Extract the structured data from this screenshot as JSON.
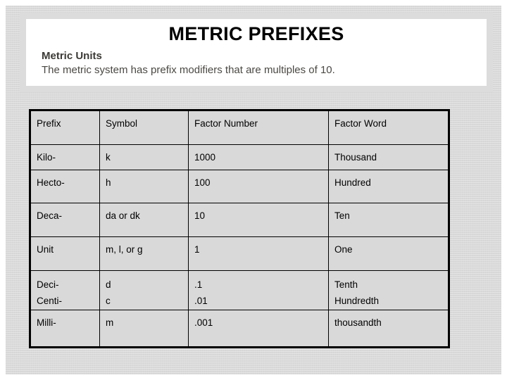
{
  "slide": {
    "title": "METRIC PREFIXES",
    "subhead": "Metric Units",
    "subtext": "The metric system has prefix modifiers that are multiples of 10.",
    "background_color": "#d9d9d9",
    "header_frame_color": "#dcdcdc",
    "header_inner_color": "#ffffff",
    "title_color": "#000000",
    "subhead_color": "#3c3a36",
    "subtext_color": "#4a4843"
  },
  "table": {
    "border_color": "#000000",
    "cell_background": "#d9d9d9",
    "text_color": "#000000",
    "headers": [
      "Prefix",
      "Symbol",
      "Factor Number",
      "Factor Word"
    ],
    "rows": [
      {
        "prefix": "Kilo-",
        "symbol": "k",
        "factor_number": "1000",
        "factor_word": "Thousand"
      },
      {
        "prefix": "Hecto-",
        "symbol": "h",
        "factor_number": "100",
        "factor_word": "Hundred"
      },
      {
        "prefix": "Deca-",
        "symbol": "da or dk",
        "factor_number": "10",
        "factor_word": "Ten"
      },
      {
        "prefix": "Unit",
        "symbol": "m, l, or g",
        "factor_number": "1",
        "factor_word": "One"
      },
      {
        "prefix": "Deci-",
        "symbol": "d",
        "factor_number": ".1",
        "factor_word": "Tenth"
      },
      {
        "prefix": "Centi-",
        "symbol": "c",
        "factor_number": ".01",
        "factor_word": "Hundredth"
      },
      {
        "prefix": "Milli-",
        "symbol": "m",
        "factor_number": ".001",
        "factor_word": "thousandth"
      }
    ]
  }
}
